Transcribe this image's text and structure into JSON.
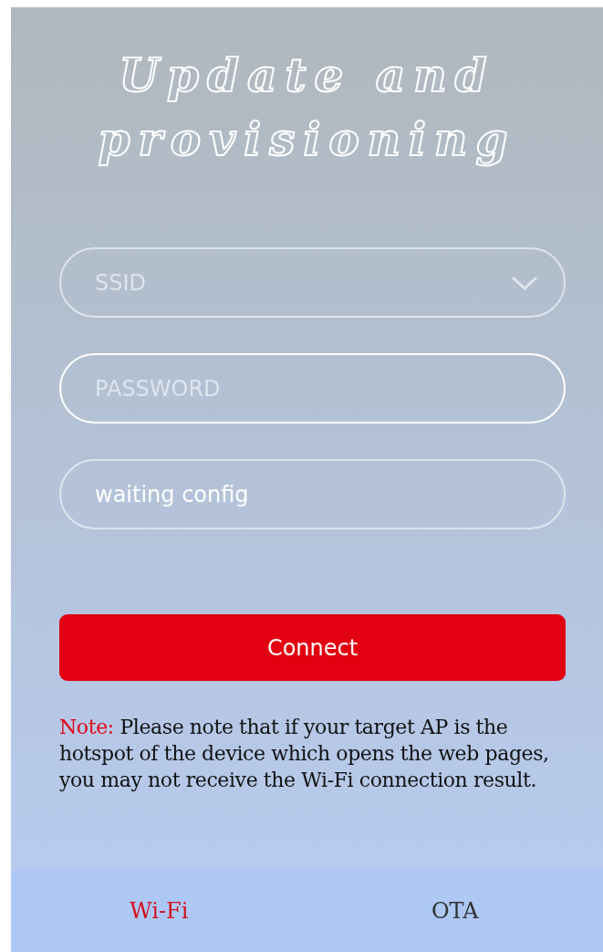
{
  "title": "Update and provisioning",
  "fields": [
    {
      "kind": "select",
      "placeholder": "SSID",
      "focused": false
    },
    {
      "kind": "password",
      "placeholder": "PASSWORD",
      "focused": true
    },
    {
      "kind": "text",
      "value": "waiting config",
      "focused": false
    }
  ],
  "button": {
    "label": "Connect"
  },
  "note": {
    "label": "Note:",
    "text": "Please note that if your target AP is the hotspot of the device which opens the web pages, you may not receive the Wi-Fi connection result."
  },
  "tabs": [
    {
      "label": "Wi-Fi",
      "selected": true
    },
    {
      "label": "OTA",
      "selected": false
    }
  ]
}
